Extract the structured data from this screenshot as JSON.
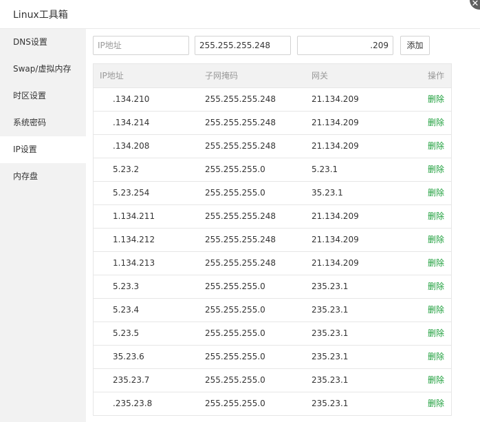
{
  "window": {
    "title": "Linux工具箱",
    "close_glyph": "✕"
  },
  "sidebar": {
    "items": [
      {
        "label": "DNS设置",
        "active": false
      },
      {
        "label": "Swap/虚拟内存",
        "active": false
      },
      {
        "label": "时区设置",
        "active": false
      },
      {
        "label": "系统密码",
        "active": false
      },
      {
        "label": "IP设置",
        "active": true
      },
      {
        "label": "内存盘",
        "active": false
      }
    ]
  },
  "form": {
    "ip_placeholder": "IP地址",
    "mask_value": "255.255.255.248",
    "gateway_value": ".209",
    "add_label": "添加"
  },
  "table": {
    "headers": {
      "ip": "IP地址",
      "mask": "子网掩码",
      "gateway": "网关",
      "action": "操作"
    },
    "rows": [
      {
        "ip": ".134.210",
        "mask": "255.255.255.248",
        "gateway": "21.134.209",
        "action": "删除"
      },
      {
        "ip": ".134.214",
        "mask": "255.255.255.248",
        "gateway": "21.134.209",
        "action": "删除"
      },
      {
        "ip": ".134.208",
        "mask": "255.255.255.248",
        "gateway": "21.134.209",
        "action": "删除"
      },
      {
        "ip": "5.23.2",
        "mask": "255.255.255.0",
        "gateway": "5.23.1",
        "action": "删除"
      },
      {
        "ip": "5.23.254",
        "mask": "255.255.255.0",
        "gateway": "35.23.1",
        "action": "删除"
      },
      {
        "ip": "1.134.211",
        "mask": "255.255.255.248",
        "gateway": "21.134.209",
        "action": "删除"
      },
      {
        "ip": "1.134.212",
        "mask": "255.255.255.248",
        "gateway": "21.134.209",
        "action": "删除"
      },
      {
        "ip": "1.134.213",
        "mask": "255.255.255.248",
        "gateway": "21.134.209",
        "action": "删除"
      },
      {
        "ip": "5.23.3",
        "mask": "255.255.255.0",
        "gateway": "235.23.1",
        "action": "删除"
      },
      {
        "ip": "5.23.4",
        "mask": "255.255.255.0",
        "gateway": "235.23.1",
        "action": "删除"
      },
      {
        "ip": "5.23.5",
        "mask": "255.255.255.0",
        "gateway": "235.23.1",
        "action": "删除"
      },
      {
        "ip": "35.23.6",
        "mask": "255.255.255.0",
        "gateway": "235.23.1",
        "action": "删除"
      },
      {
        "ip": "235.23.7",
        "mask": "255.255.255.0",
        "gateway": "235.23.1",
        "action": "删除"
      },
      {
        "ip": ".235.23.8",
        "mask": "255.255.255.0",
        "gateway": "235.23.1",
        "action": "删除"
      }
    ]
  },
  "colors": {
    "accent_green": "#1e9f3c",
    "sidebar_bg": "#f2f2f2",
    "header_bg": "#f2f2f2",
    "border": "#e6e6e6"
  }
}
